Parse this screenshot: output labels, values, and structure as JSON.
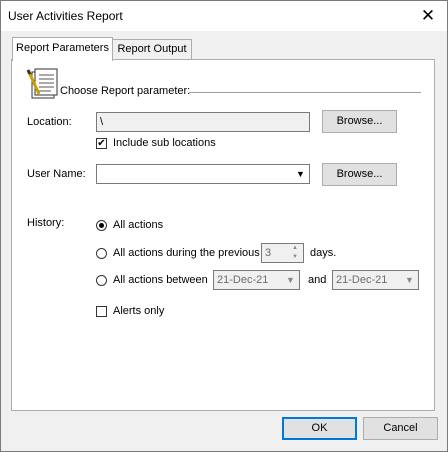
{
  "window": {
    "title": "User Activities Report",
    "close_glyph": "✕"
  },
  "tabs": [
    {
      "label": "Report Parameters"
    },
    {
      "label": "Report Output"
    }
  ],
  "panel": {
    "section_title": "Choose Report parameter:",
    "location": {
      "label": "Location:",
      "value": "\\",
      "browse_label": "Browse..."
    },
    "include_sub": {
      "label": "Include sub locations",
      "checked": true
    },
    "user_name": {
      "label": "User Name:",
      "value": "",
      "browse_label": "Browse..."
    },
    "history": {
      "label": "History:",
      "all_actions_label": "All actions",
      "previous_label": "All actions during the previous",
      "previous_days": "3",
      "days_label": "days.",
      "between_label": "All actions between",
      "from_date": "21-Dec-21",
      "and_label": "and",
      "to_date": "21-Dec-21",
      "selected": "all_actions"
    },
    "alerts_only": {
      "label": "Alerts only",
      "checked": false
    }
  },
  "buttons": {
    "ok_label": "OK",
    "cancel_label": "Cancel"
  },
  "colors": {
    "accent": "#0078d7"
  }
}
